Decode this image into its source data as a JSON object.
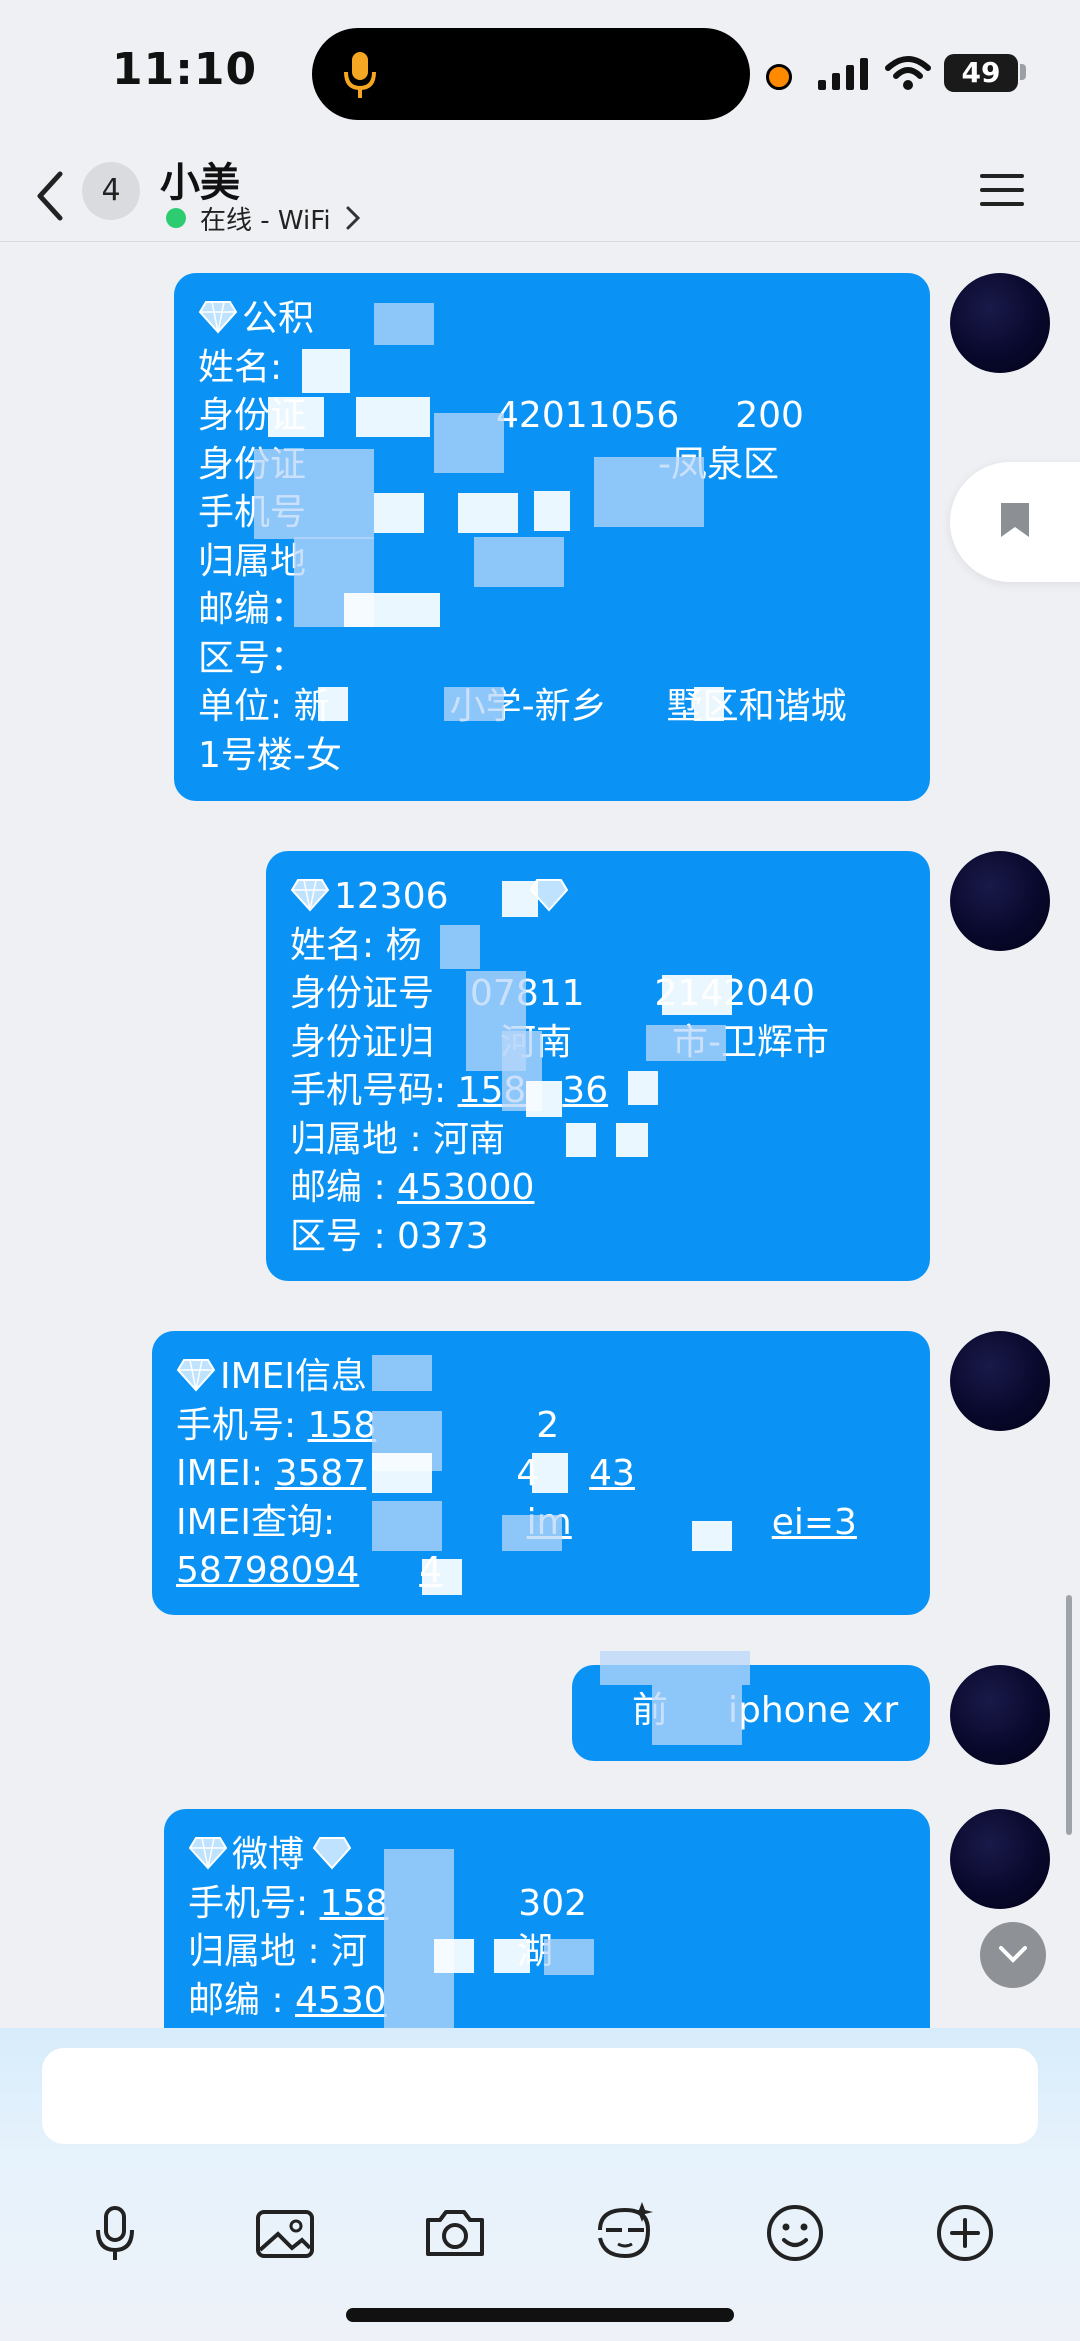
{
  "status_bar": {
    "time": "11:10",
    "battery": "49"
  },
  "header": {
    "unread_count": "4",
    "contact_name": "小美",
    "online_status": "在线 - WiFi"
  },
  "messages": [
    {
      "lines": [
        "公积",
        "姓名: ",
        "身份证",
        "身份证",
        "手机号",
        "归属地",
        "邮编：",
        "区号：",
        "单位: 新",
        "1号楼-女"
      ],
      "fragments": {
        "id_digits": "42011056",
        "id_tail": "200",
        "district": "-凤泉区",
        "school": "小学-新乡",
        "area": "墅区和谐城"
      }
    },
    {
      "lines": [
        "12306",
        "姓名: 杨",
        "身份证号",
        "身份证归",
        "手机号码: ",
        "归属地 : 河南",
        "邮编 : ",
        "区号 : 0373"
      ],
      "fragments": {
        "id_part": "07811",
        "id_tail": "2142040",
        "province": "河南",
        "city": "市-卫辉市",
        "phone_a": "158",
        "phone_b": "36",
        "postcode": "453000"
      }
    },
    {
      "lines": [
        "IMEI信息",
        "手机号: ",
        "IMEI: ",
        "IMEI查询: ",
        "58798094"
      ],
      "fragments": {
        "phone": "158",
        "phone_tail": "2",
        "imei_head": "3587",
        "imei_mid": "4",
        "imei_tail": "43",
        "query_im": "im",
        "query_tail": "ei=3",
        "wrap_tail": "4"
      }
    },
    {
      "lines": [
        "前",
        "iphone xr"
      ]
    },
    {
      "lines": [
        "微博",
        "手机号: ",
        "归属地 : 河",
        "邮编 : "
      ],
      "fragments": {
        "phone": "158",
        "phone_tail": "302",
        "place_tail": "湖",
        "postcode": "4530"
      }
    }
  ],
  "input": {
    "placeholder": ""
  },
  "toolbar_icons": [
    "microphone-icon",
    "image-icon",
    "camera-icon",
    "sticker-icon",
    "emoji-icon",
    "plus-icon"
  ],
  "colors": {
    "bubble": "#0a93f5",
    "background": "#eef0f4",
    "online": "#2ecc71"
  }
}
